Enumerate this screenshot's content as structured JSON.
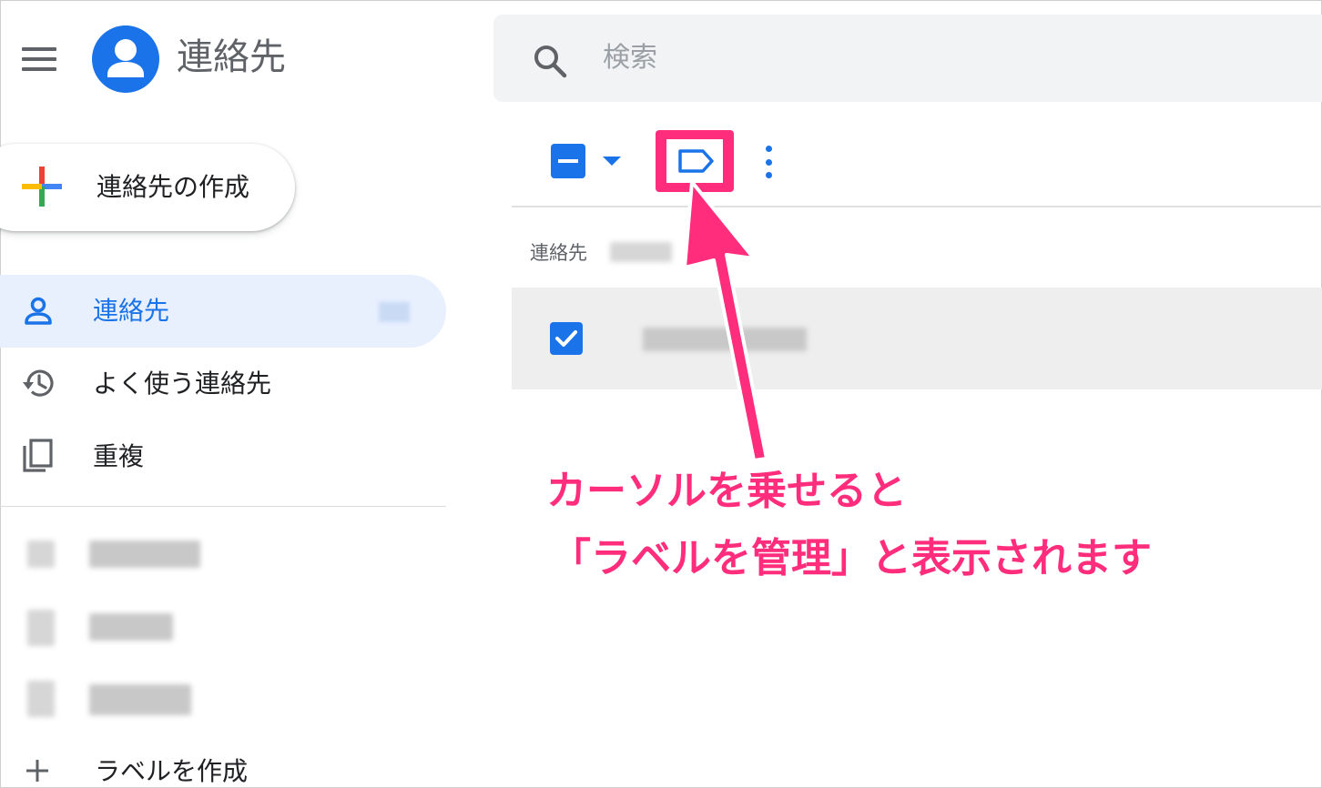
{
  "header": {
    "app_title": "連絡先",
    "search_placeholder": "検索"
  },
  "sidebar": {
    "create_button": "連絡先の作成",
    "items": [
      {
        "label": "連絡先",
        "icon": "person-icon",
        "active": true
      },
      {
        "label": "よく使う連絡先",
        "icon": "history-icon",
        "active": false
      },
      {
        "label": "重複",
        "icon": "duplicate-icon",
        "active": false
      }
    ],
    "create_label": "ラベルを作成"
  },
  "list": {
    "header": "連絡先"
  },
  "annotation": {
    "line1": "カーソルを乗せると",
    "line2": "「ラベルを管理」と表示されます"
  },
  "colors": {
    "accent": "#1a73e8",
    "active_bg": "#e8f0fe",
    "highlight": "#ff2d7b"
  }
}
